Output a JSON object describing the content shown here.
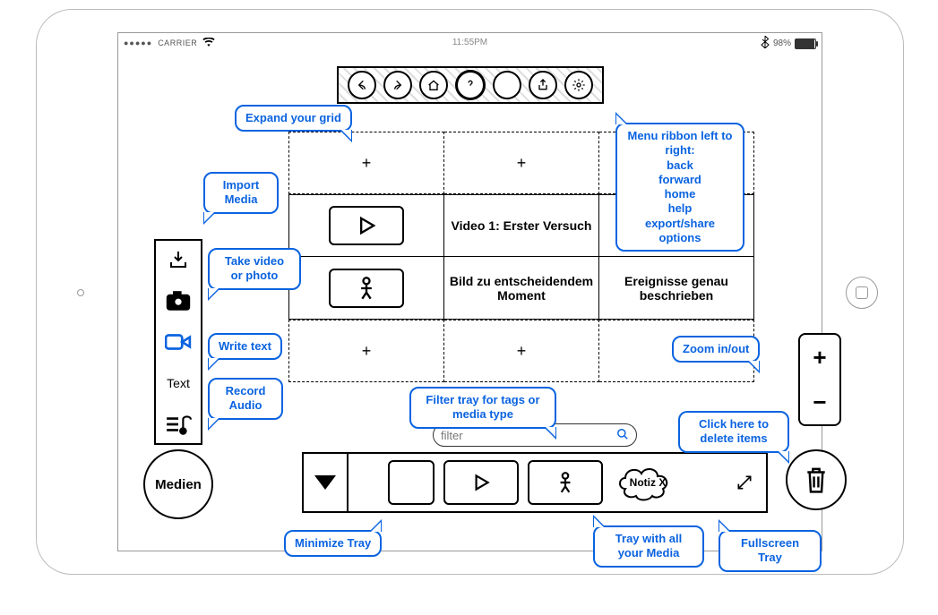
{
  "status": {
    "carrier": "CARRIER",
    "time": "11:55PM",
    "battery": "98%"
  },
  "menu_ribbon": {
    "items": [
      "back",
      "forward",
      "home",
      "help",
      "record",
      "export-share",
      "options"
    ]
  },
  "toolbar": {
    "text_label": "Text",
    "medien_label": "Medien"
  },
  "grid": {
    "cells": {
      "video1": "Video 1: Erster Versuch",
      "bild": "Bild zu entscheidendem Moment",
      "ereignisse": "Ereignisse genau beschrieben"
    }
  },
  "filter": {
    "placeholder": "filter"
  },
  "tray": {
    "note_label": "Notiz X"
  },
  "zoom": {
    "plus": "+",
    "minus": "−"
  },
  "callouts": {
    "expand_grid": "Expand your grid",
    "menu_ribbon": "Menu ribbon left to right:\nback\nforward\nhome\nhelp\nexport/share\noptions",
    "import_media": "Import Media",
    "take_video_photo": "Take video or photo",
    "write_text": "Write text",
    "record_audio": "Record Audio",
    "filter_tray": "Filter tray for tags or media type",
    "zoom": "Zoom in/out",
    "click_delete": "Click here to delete items",
    "minimize_tray": "Minimize Tray",
    "media_tray": "Tray with all your Media",
    "fullscreen_tray": "Fullscreen Tray"
  }
}
